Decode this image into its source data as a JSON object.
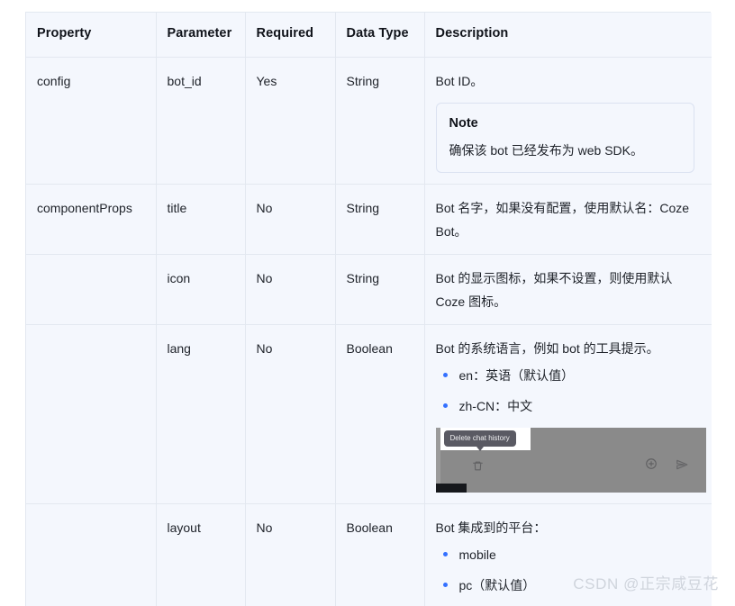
{
  "table": {
    "headers": [
      "Property",
      "Parameter",
      "Required",
      "Data Type",
      "Description"
    ],
    "rows": [
      {
        "property": "config",
        "parameter": "bot_id",
        "required": "Yes",
        "data_type": "String",
        "description_lead": "Bot ID。",
        "note": {
          "title": "Note",
          "body": "确保该 bot 已经发布为 web SDK。"
        }
      },
      {
        "property": "componentProps",
        "parameter": "title",
        "required": "No",
        "data_type": "String",
        "description_lead": "Bot 名字，如果没有配置，使用默认名：Coze Bot。"
      },
      {
        "property": "",
        "parameter": "icon",
        "required": "No",
        "data_type": "String",
        "description_lead": "Bot 的显示图标，如果不设置，则使用默认 Coze 图标。"
      },
      {
        "property": "",
        "parameter": "lang",
        "required": "No",
        "data_type": "Boolean",
        "description_lead": "Bot 的系统语言，例如 bot 的工具提示。",
        "bullets": [
          "en：英语（默认值）",
          "zh-CN：中文"
        ],
        "screenshot": {
          "tooltip_label": "Delete chat history",
          "icons": [
            "trash-icon",
            "plus-circle-icon",
            "send-icon"
          ]
        }
      },
      {
        "property": "",
        "parameter": "layout",
        "required": "No",
        "data_type": "Boolean",
        "description_lead": "Bot 集成到的平台：",
        "bullets": [
          "mobile",
          "pc（默认值）"
        ]
      }
    ]
  },
  "watermark": "CSDN @正宗咸豆花",
  "colors": {
    "table_bg": "#f4f7fd",
    "border": "#e3e8f0",
    "bullet": "#3370ff",
    "text": "#20242b",
    "watermark": "#cfd4dc"
  }
}
